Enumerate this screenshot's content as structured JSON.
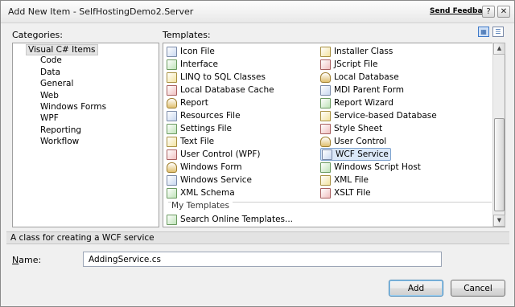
{
  "window": {
    "title": "Add New Item - SelfHostingDemo2.Server",
    "send_feedback": "Send Feedback",
    "help_glyph": "?",
    "close_glyph": "✕"
  },
  "categories": {
    "label": "Categories:",
    "items": [
      {
        "label": "Visual C# Items",
        "selected": true
      },
      {
        "label": "Code"
      },
      {
        "label": "Data"
      },
      {
        "label": "General"
      },
      {
        "label": "Web"
      },
      {
        "label": "Windows Forms"
      },
      {
        "label": "WPF"
      },
      {
        "label": "Reporting"
      },
      {
        "label": "Workflow"
      }
    ]
  },
  "templates": {
    "label": "Templates:",
    "left_column": [
      {
        "label": "Icon File",
        "icon": "icon-file-icon"
      },
      {
        "label": "Interface",
        "icon": "interface-icon"
      },
      {
        "label": "LINQ to SQL Classes",
        "icon": "linq-to-sql-icon"
      },
      {
        "label": "Local Database Cache",
        "icon": "database-cache-icon"
      },
      {
        "label": "Report",
        "icon": "report-icon"
      },
      {
        "label": "Resources File",
        "icon": "resources-file-icon"
      },
      {
        "label": "Settings File",
        "icon": "settings-file-icon"
      },
      {
        "label": "Text File",
        "icon": "text-file-icon"
      },
      {
        "label": "User Control (WPF)",
        "icon": "wpf-user-control-icon"
      },
      {
        "label": "Windows Form",
        "icon": "windows-form-icon"
      },
      {
        "label": "Windows Service",
        "icon": "windows-service-icon"
      },
      {
        "label": "XML Schema",
        "icon": "xml-schema-icon"
      }
    ],
    "right_column": [
      {
        "label": "Installer Class",
        "icon": "installer-class-icon"
      },
      {
        "label": "JScript File",
        "icon": "jscript-file-icon"
      },
      {
        "label": "Local Database",
        "icon": "local-database-icon"
      },
      {
        "label": "MDI Parent Form",
        "icon": "mdi-parent-form-icon"
      },
      {
        "label": "Report Wizard",
        "icon": "report-wizard-icon"
      },
      {
        "label": "Service-based Database",
        "icon": "service-database-icon"
      },
      {
        "label": "Style Sheet",
        "icon": "style-sheet-icon"
      },
      {
        "label": "User Control",
        "icon": "user-control-icon"
      },
      {
        "label": "WCF Service",
        "icon": "wcf-service-icon",
        "selected": true
      },
      {
        "label": "Windows Script Host",
        "icon": "script-host-icon"
      },
      {
        "label": "XML File",
        "icon": "xml-file-icon"
      },
      {
        "label": "XSLT File",
        "icon": "xslt-file-icon"
      }
    ],
    "my_templates_label": "My Templates",
    "search_online_label": "Search Online Templates..."
  },
  "description": "A class for creating a WCF service",
  "name_field": {
    "label": "Name:",
    "value": "AddingService.cs"
  },
  "buttons": {
    "add": "Add",
    "cancel": "Cancel"
  }
}
